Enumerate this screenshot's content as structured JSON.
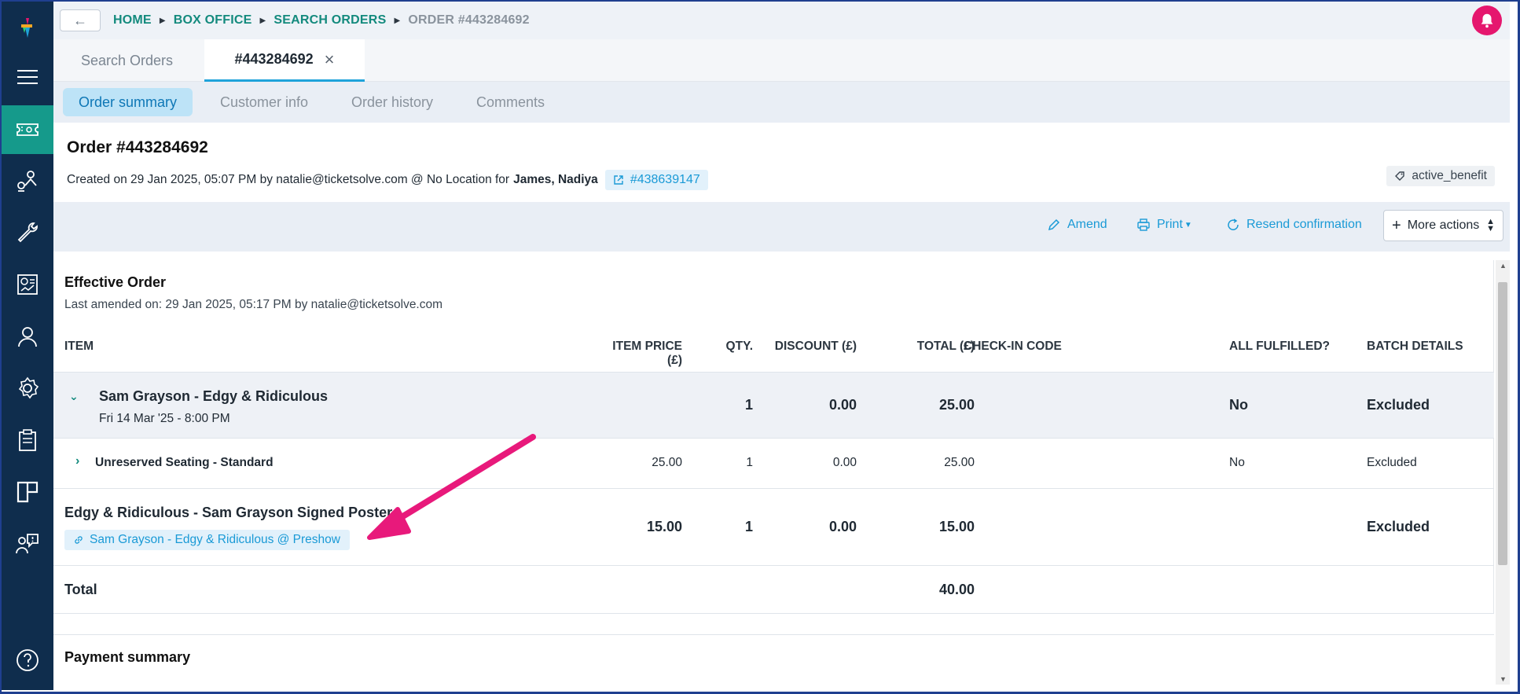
{
  "breadcrumb": {
    "home": "HOME",
    "box_office": "BOX OFFICE",
    "search_orders": "SEARCH ORDERS",
    "current": "ORDER #443284692"
  },
  "order_tabs": {
    "search": "Search Orders",
    "order": "#443284692"
  },
  "sub_tabs": {
    "summary": "Order summary",
    "customer": "Customer info",
    "history": "Order history",
    "comments": "Comments"
  },
  "order": {
    "title": "Order #443284692",
    "created_text": "Created on 29 Jan 2025, 05:07 PM by natalie@ticketsolve.com @ No Location for",
    "customer_name": "James, Nadiya",
    "customer_link": "#438639147",
    "tag": "active_benefit"
  },
  "actions": {
    "amend": "Amend",
    "print": "Print",
    "resend": "Resend confirmation",
    "more": "More actions"
  },
  "effective_order": {
    "title": "Effective Order",
    "amended": "Last amended on: 29 Jan 2025, 05:17 PM by natalie@ticketsolve.com"
  },
  "table": {
    "headers": {
      "item": "ITEM",
      "item_price": "ITEM PRICE (£)",
      "qty": "QTY.",
      "discount": "DISCOUNT (£)",
      "total": "TOTAL (£)",
      "checkin": "CHECK-IN CODE",
      "fulfilled": "ALL FULFILLED?",
      "batch": "BATCH DETAILS"
    },
    "event_row": {
      "name": "Sam Grayson - Edgy & Ridiculous",
      "date": "Fri 14 Mar '25 - 8:00 PM",
      "qty": "1",
      "discount": "0.00",
      "total": "25.00",
      "fulfilled": "No",
      "batch": "Excluded"
    },
    "seating_row": {
      "name": "Unreserved Seating - Standard",
      "price": "25.00",
      "qty": "1",
      "discount": "0.00",
      "total": "25.00",
      "fulfilled": "No",
      "batch": "Excluded"
    },
    "poster_row": {
      "name": "Edgy & Ridiculous - Sam Grayson Signed Poster",
      "linked_event": "Sam Grayson - Edgy & Ridiculous @ Preshow",
      "price": "15.00",
      "qty": "1",
      "discount": "0.00",
      "total": "15.00",
      "batch": "Excluded"
    },
    "total_row": {
      "label": "Total",
      "total": "40.00"
    }
  },
  "payment": {
    "title": "Payment summary"
  },
  "colors": {
    "sidebar": "#0f2d4d",
    "sidebar_active": "#159a8b",
    "link": "#1a9ad6",
    "breadcrumb": "#138a7d",
    "bell": "#e5176e",
    "arrow": "#e8197b"
  },
  "icons": {
    "sidebar": [
      "logo-icon",
      "menu-icon",
      "ticket-icon",
      "user-tree-icon",
      "wrench-icon",
      "report-icon",
      "person-icon",
      "gear-icon",
      "clipboard-icon",
      "layout-icon",
      "support-icon",
      "help-icon"
    ]
  }
}
